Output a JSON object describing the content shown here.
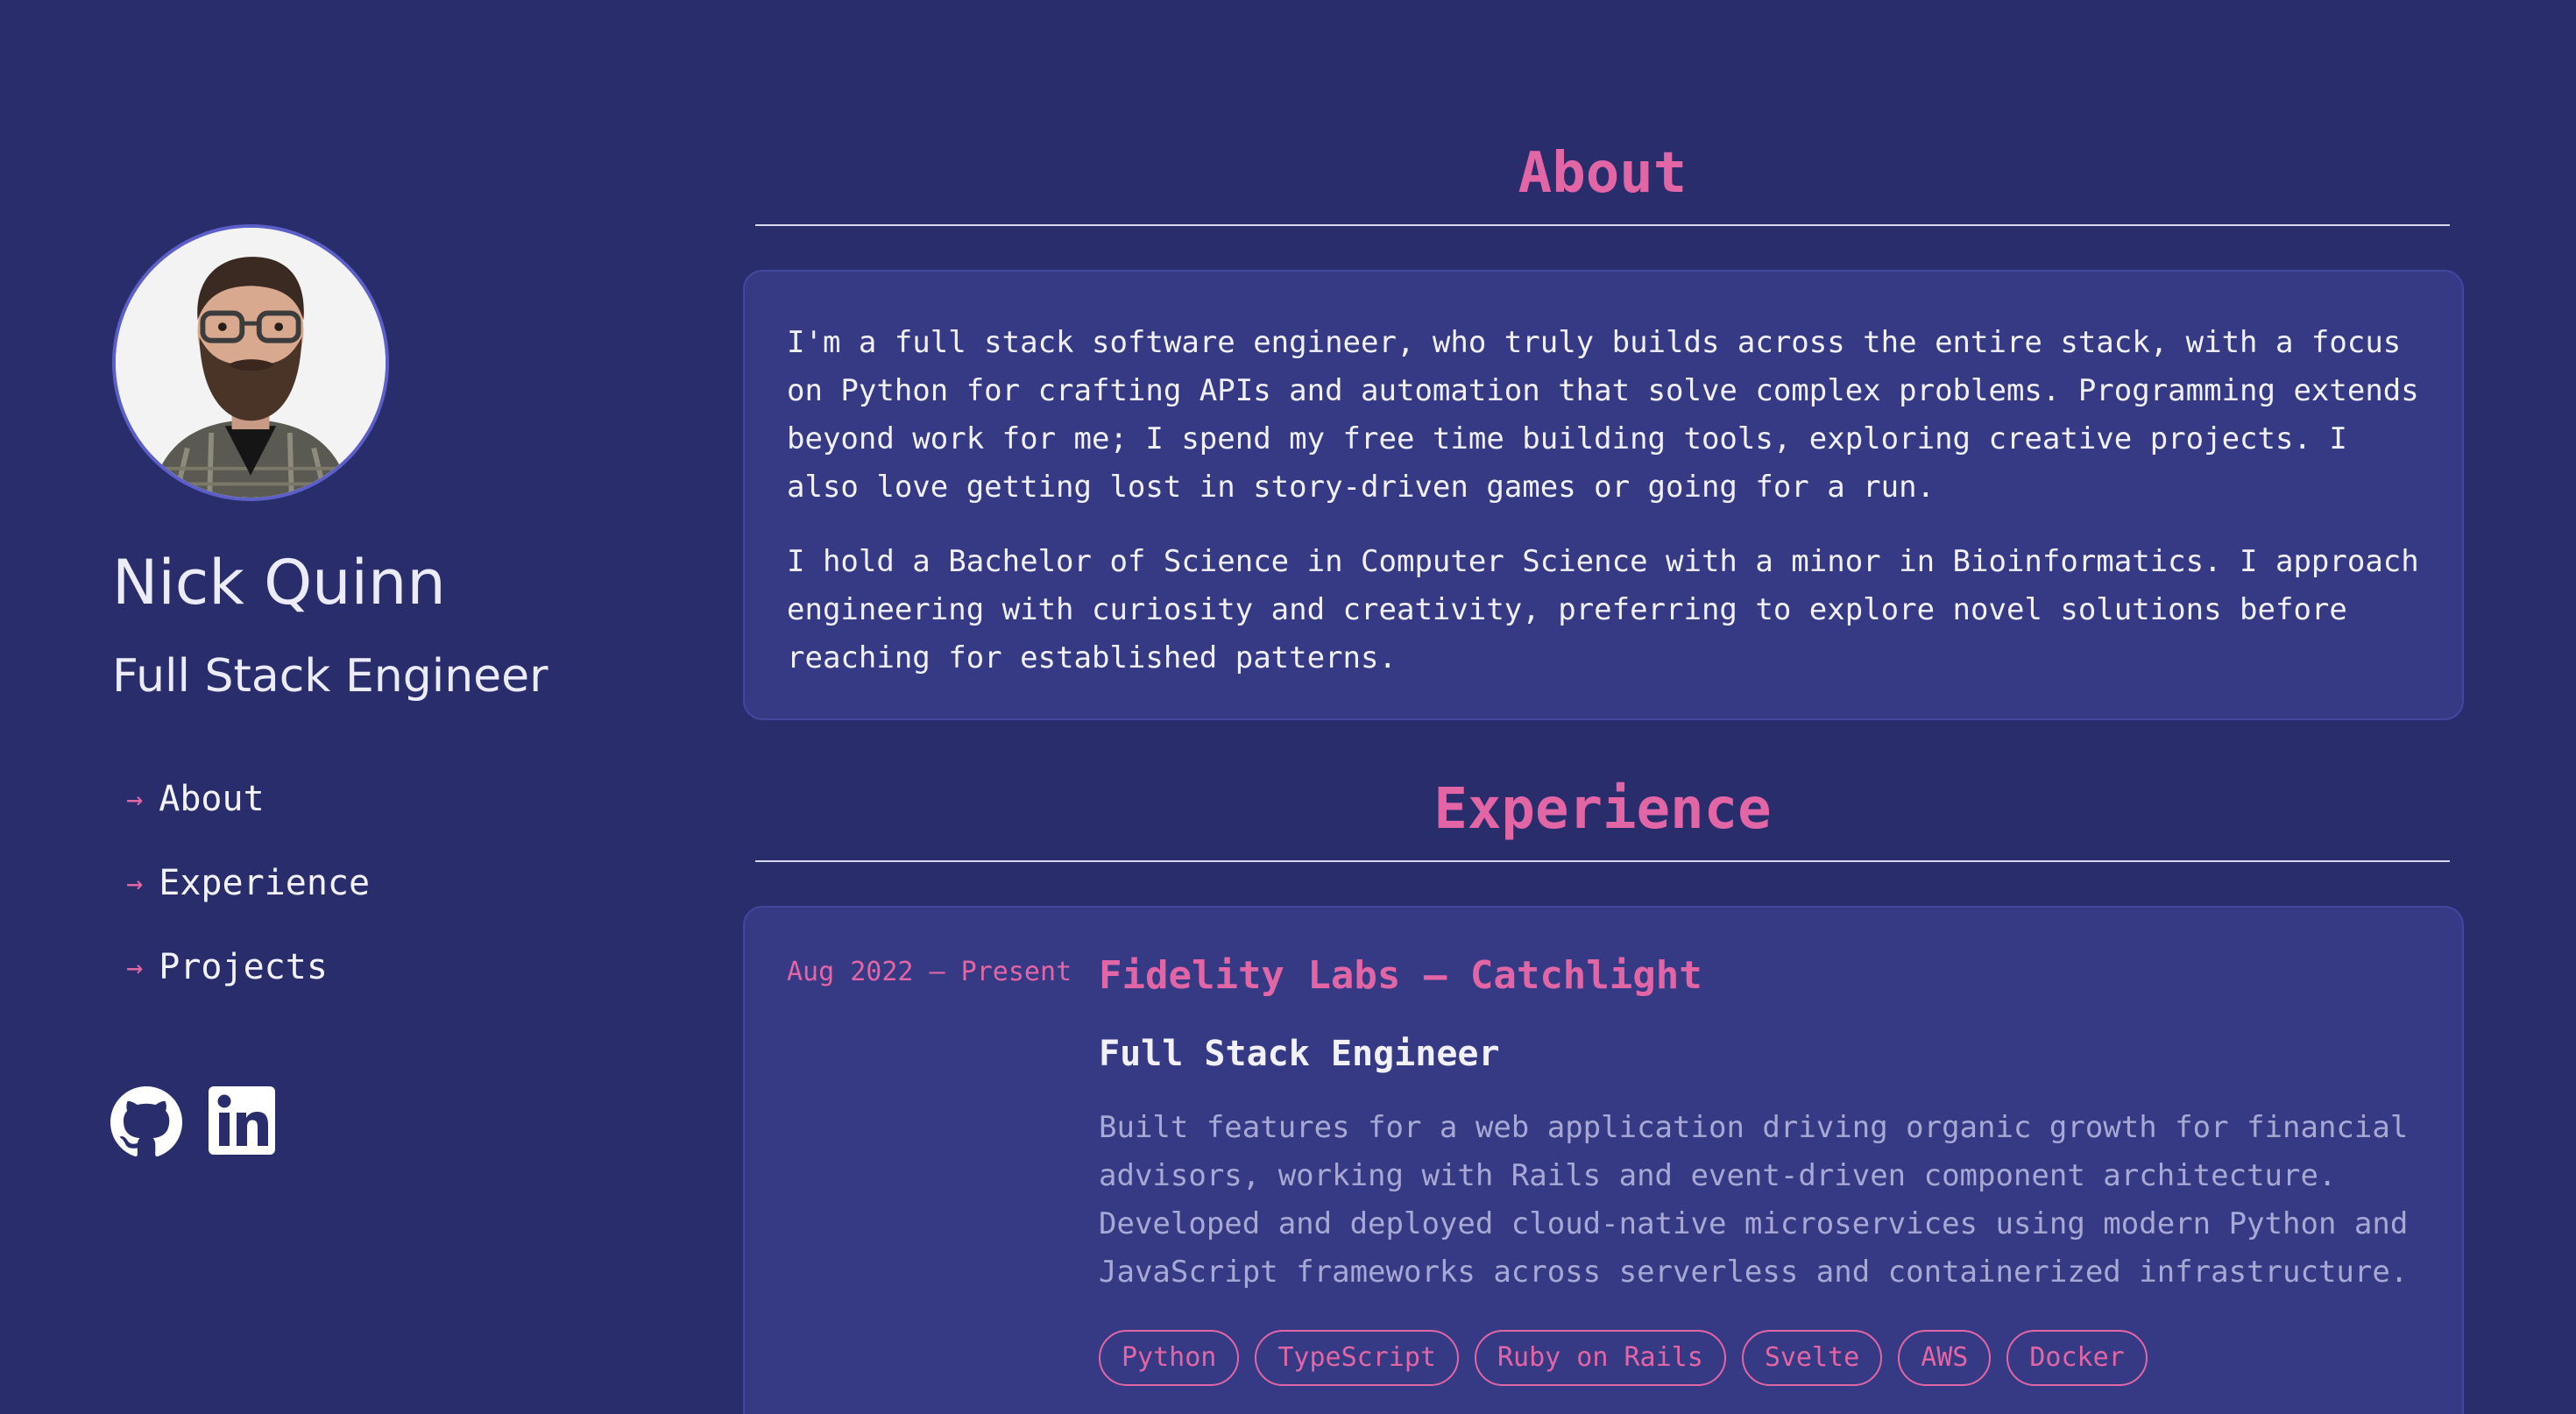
{
  "profile": {
    "name": "Nick Quinn",
    "role": "Full Stack Engineer"
  },
  "nav": {
    "items": [
      {
        "label": "About",
        "icon": "arrow-right-icon"
      },
      {
        "label": "Experience",
        "icon": "arrow-right-icon"
      },
      {
        "label": "Projects",
        "icon": "arrow-right-icon"
      }
    ]
  },
  "socials": [
    {
      "icon": "github-icon"
    },
    {
      "icon": "linkedin-icon"
    }
  ],
  "about": {
    "title": "About",
    "paragraphs": [
      "I'm a full stack software engineer, who truly builds across the entire stack, with a focus on Python for crafting APIs and automation that solve complex problems. Programming extends beyond work for me; I spend my free time building tools, exploring creative projects. I also love getting lost in story-driven games or going for a run.",
      "I hold a Bachelor of Science in Computer Science with a minor in Bioinformatics. I approach engineering with curiosity and creativity, preferring to explore novel solutions before reaching for established patterns."
    ]
  },
  "experience": {
    "title": "Experience",
    "jobs": [
      {
        "dates": "Aug 2022 – Present",
        "company": "Fidelity Labs – Catchlight",
        "title": "Full Stack Engineer",
        "description": "Built features for a web application driving organic growth for financial advisors, working with Rails and event-driven component architecture. Developed and deployed cloud-native microservices using modern Python and JavaScript frameworks across serverless and containerized infrastructure.",
        "tags": [
          "Python",
          "TypeScript",
          "Ruby on Rails",
          "Svelte",
          "AWS",
          "Docker"
        ]
      }
    ]
  },
  "colors": {
    "background": "#2a2d6c",
    "card": "#363a85",
    "accent": "#e266a6",
    "text": "#f2f1fb",
    "muted_text": "#a8a8d4"
  }
}
